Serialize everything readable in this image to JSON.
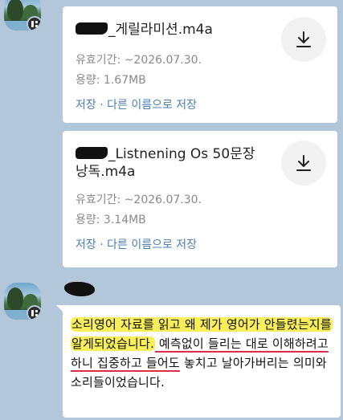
{
  "messages": [
    {
      "type": "file",
      "file_name": "_게릴라미션.m4a",
      "expiry": "유효기간: ~2026.07.30.",
      "size": "용량: 1.67MB",
      "save_label": "저장",
      "separator": "·",
      "save_as_label": "다른 이름으로 저장",
      "download_icon": "download-icon"
    },
    {
      "type": "file",
      "file_name": "_Listnening Os 50문장 낭독.m4a",
      "expiry": "유효기간: ~2026.07.30.",
      "size": "용량: 3.14MB",
      "save_label": "저장",
      "separator": "·",
      "save_as_label": "다른 이름으로 저장",
      "download_icon": "download-icon"
    },
    {
      "type": "text",
      "text_highlighted": "소리영어 자료를 읽고 왜 제가 영어가 안들렸는지를 알게되었습니다.",
      "text_underlined": " 예측없이 들리는 대로 이해하려고 하니 집중하고 들어도",
      "text_plain": " 놓치고 날아가버리는 의미와 소리들이었습니다."
    }
  ],
  "colors": {
    "chat_background": "#b2c7da",
    "link": "#4a7fb5",
    "highlight": "#f8ee5a",
    "underline": "#d9304a"
  }
}
